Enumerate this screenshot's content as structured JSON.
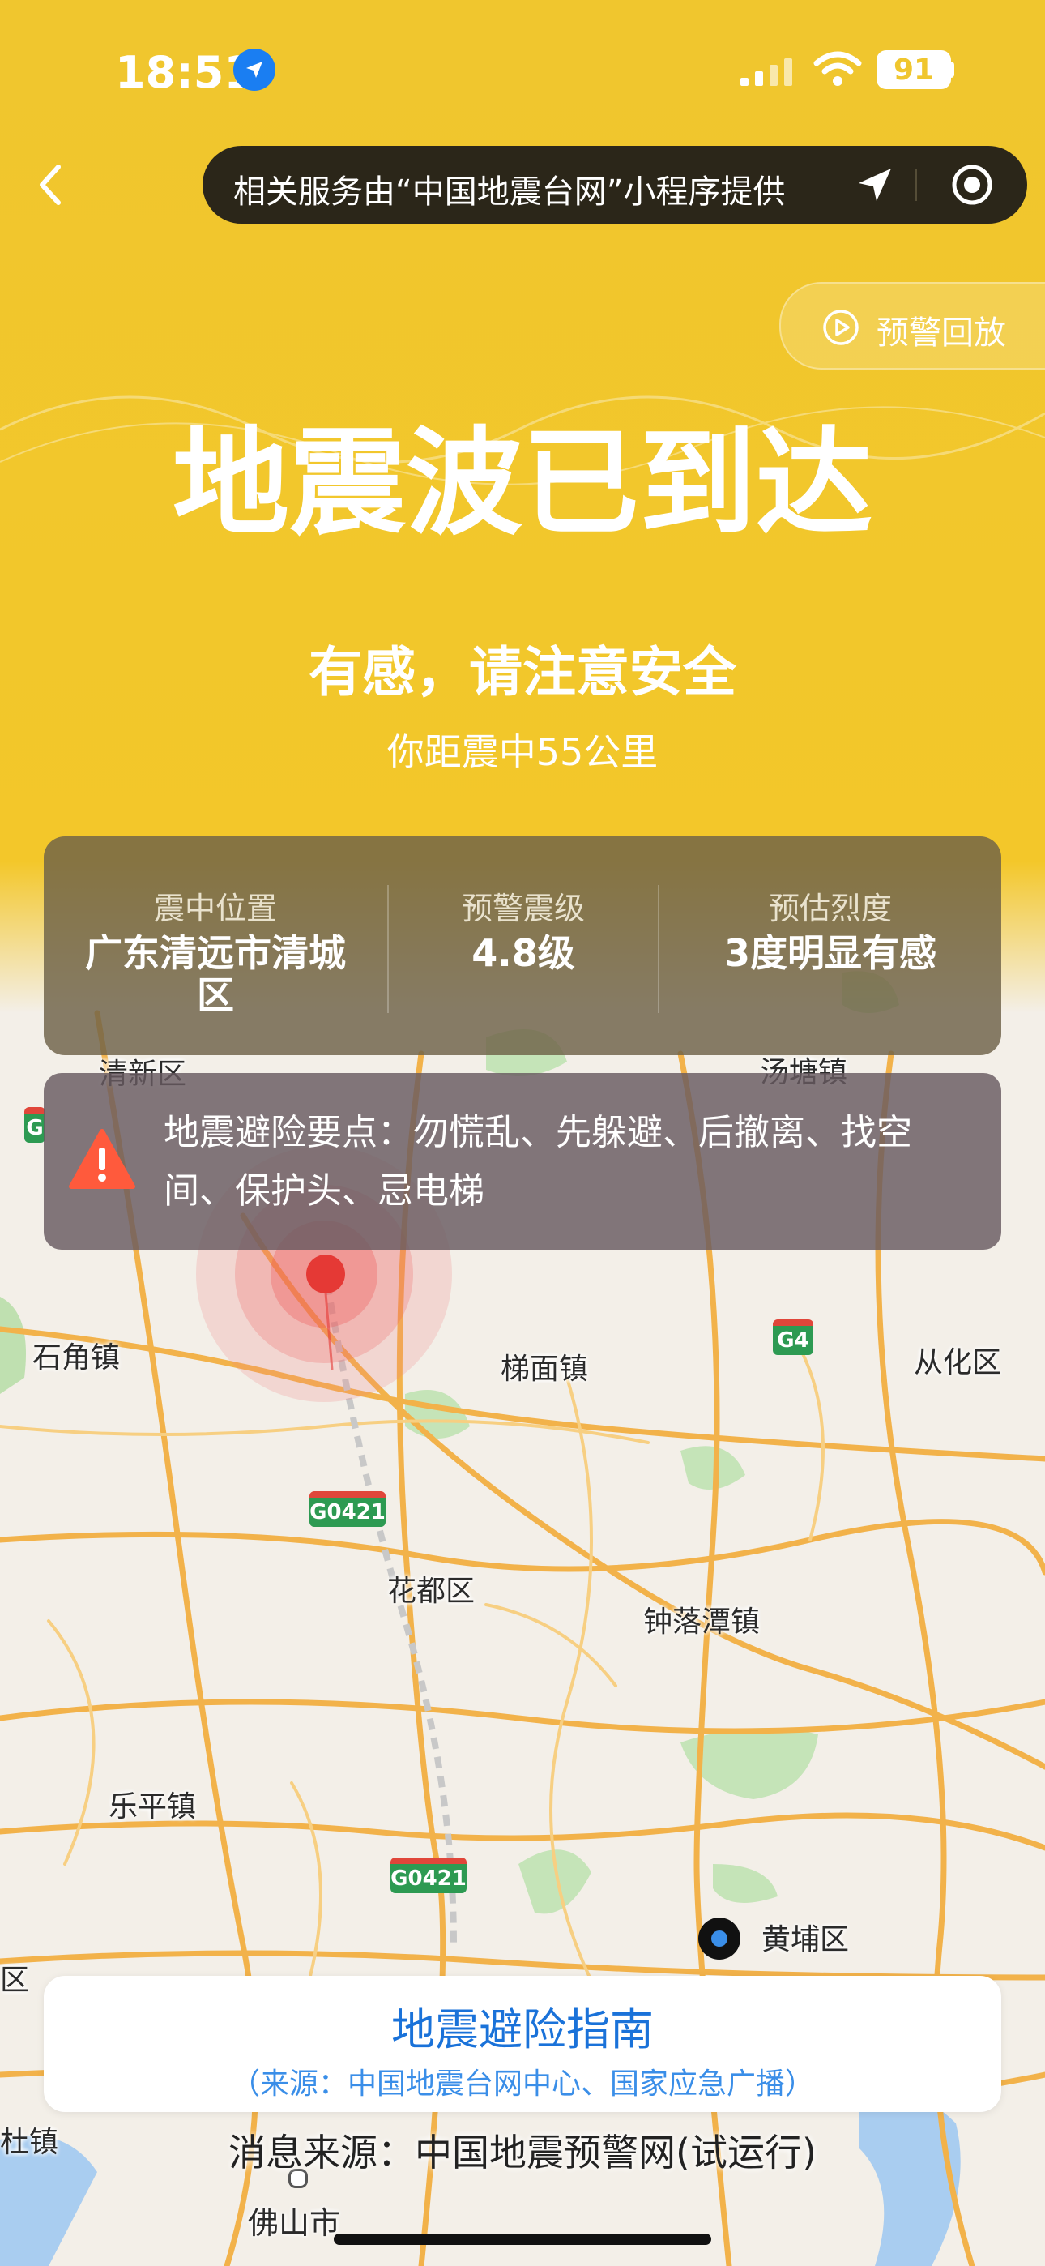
{
  "status_bar": {
    "time": "18:51",
    "battery": "91"
  },
  "navbar": {
    "provider_text": "相关服务由“中国地震台网”小程序提供"
  },
  "replay": {
    "label": "预警回放"
  },
  "alert": {
    "title": "地震波已到达",
    "subtitle": "有感，请注意安全",
    "distance": "你距震中55公里"
  },
  "info": [
    {
      "label": "震中位置",
      "value": "广东清远市清城区"
    },
    {
      "label": "预警震级",
      "value": "4.8级"
    },
    {
      "label": "预估烈度",
      "value": "3度明显有感"
    }
  ],
  "tips": {
    "text": "地震避险要点：勿慌乱、先躲避、后撤离、找空间、保护头、忌电梯"
  },
  "map": {
    "labels": [
      "清新区",
      "汤塘镇",
      "石角镇",
      "梯面镇",
      "从化区",
      "花都区",
      "钟落潭镇",
      "乐平镇",
      "黄埔区",
      "区",
      "杜镇",
      "佛山市"
    ],
    "shields": [
      "G4",
      "G0421",
      "G0421",
      "G"
    ]
  },
  "guide": {
    "title": "地震避险指南",
    "subtitle": "（来源：中国地震台网中心、国家应急广播）"
  },
  "source": {
    "text": "消息来源：中国地震预警网(试运行)"
  },
  "colors": {
    "header_yellow": "#f0c62e",
    "accent_blue": "#1a72d9",
    "epicenter_red": "#e53935"
  }
}
